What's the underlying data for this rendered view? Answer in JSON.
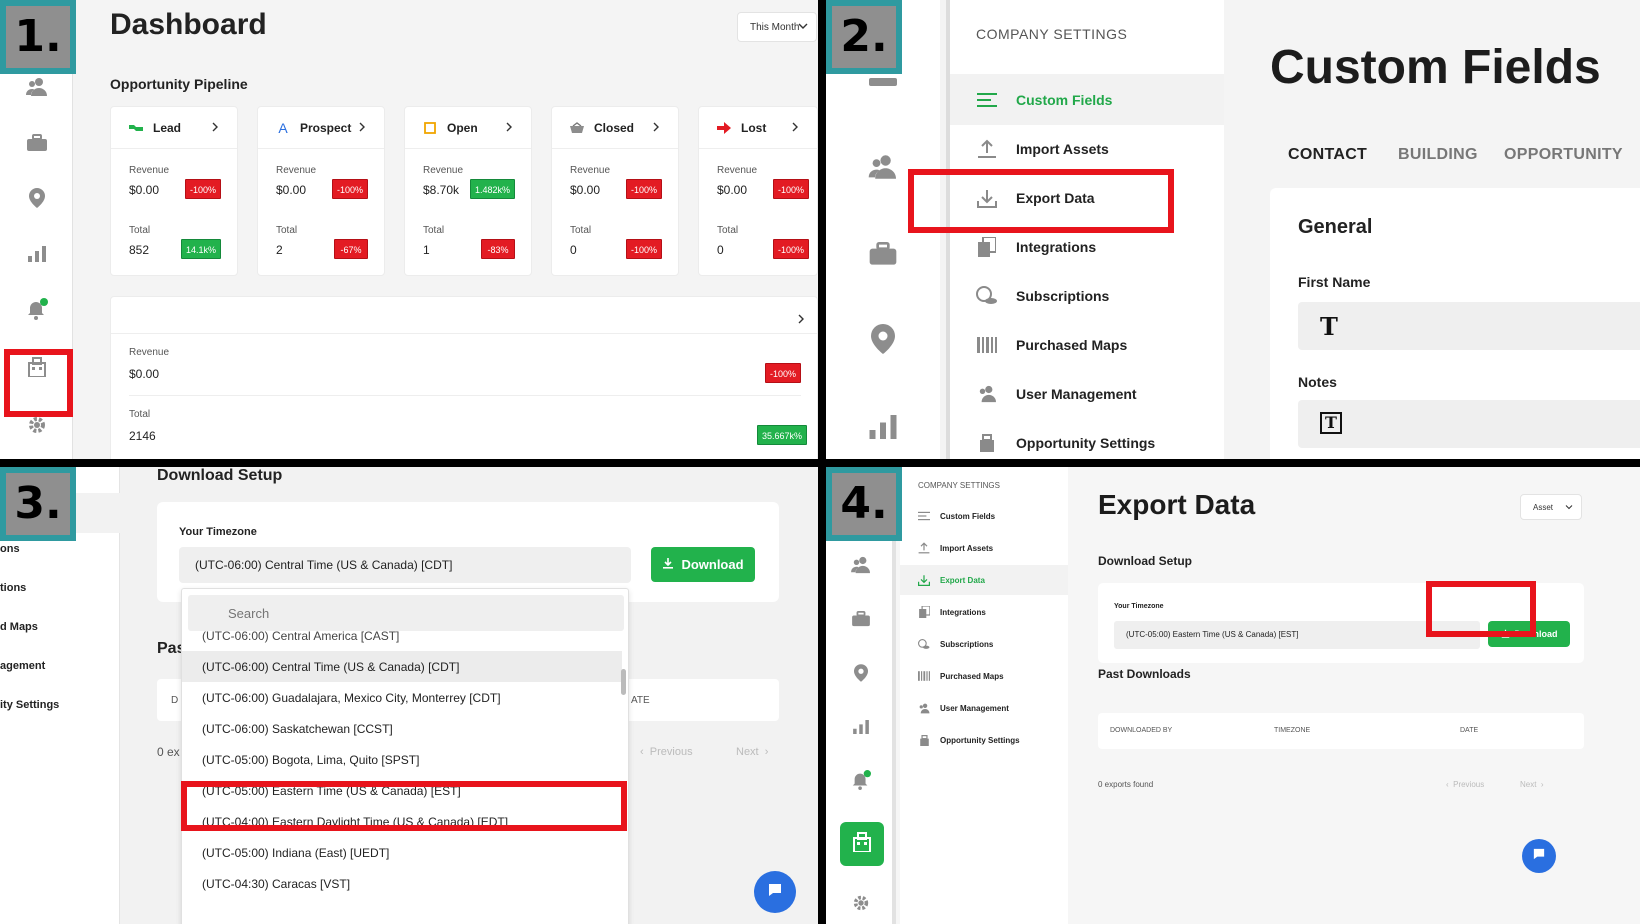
{
  "steps": [
    "1.",
    "2.",
    "3.",
    "4."
  ],
  "panel1": {
    "title": "Dashboard",
    "period_select": "This Month",
    "section_title": "Opportunity Pipeline",
    "revenue_label": "Revenue",
    "total_label": "Total",
    "stages": [
      {
        "name": "Lead",
        "revenue": "$0.00",
        "revenue_change": "-100%",
        "total": "852",
        "total_change": "14.1k%"
      },
      {
        "name": "Prospect",
        "revenue": "$0.00",
        "revenue_change": "-100%",
        "total": "2",
        "total_change": "-67%"
      },
      {
        "name": "Open",
        "revenue": "$8.70k",
        "revenue_change": "1.482k%",
        "total": "1",
        "total_change": "-83%"
      },
      {
        "name": "Closed",
        "revenue": "$0.00",
        "revenue_change": "-100%",
        "total": "0",
        "total_change": "-100%"
      },
      {
        "name": "Lost",
        "revenue": "$0.00",
        "revenue_change": "-100%",
        "total": "0",
        "total_change": "-100%"
      }
    ],
    "summary": {
      "revenue": "$0.00",
      "revenue_change": "-100%",
      "total": "2146",
      "total_change": "35.667k%"
    }
  },
  "panel2": {
    "menu_heading": "COMPANY SETTINGS",
    "menu_items": [
      "Custom Fields",
      "Import Assets",
      "Export Data",
      "Integrations",
      "Subscriptions",
      "Purchased Maps",
      "User Management",
      "Opportunity Settings"
    ],
    "title": "Custom Fields",
    "tabs": [
      "CONTACT",
      "BUILDING",
      "OPPORTUNITY"
    ],
    "card_title": "General",
    "fields": [
      {
        "label": "First Name",
        "type_glyph": "T"
      },
      {
        "label": "Notes",
        "type_glyph": "T"
      }
    ]
  },
  "panel3": {
    "sidebar_fragments": [
      "ons",
      "tions",
      "d Maps",
      "agement",
      "ity Settings"
    ],
    "title": "Download Setup",
    "timezone_label": "Your Timezone",
    "timezone_value": "(UTC-06:00) Central Time (US & Canada) [CDT]",
    "download_label": "Download",
    "past_fragment": "Pas",
    "table_fragments": [
      "D",
      "ATE"
    ],
    "count_fragment": "0 ex",
    "pager": {
      "previous": "Previous",
      "next": "Next"
    },
    "search_placeholder": "Search",
    "options": [
      "(UTC-06:00) Central America [CAST]",
      "(UTC-06:00) Central Time (US & Canada) [CDT]",
      "(UTC-06:00) Guadalajara, Mexico City, Monterrey [CDT]",
      "(UTC-06:00) Saskatchewan [CCST]",
      "(UTC-05:00) Bogota, Lima, Quito [SPST]",
      "(UTC-05:00) Eastern Time (US & Canada) [EST]",
      "(UTC-04:00) Eastern Daylight Time (US & Canada) [EDT]",
      "(UTC-05:00) Indiana (East) [UEDT]",
      "(UTC-04:30) Caracas [VST]"
    ]
  },
  "panel4": {
    "menu_heading": "COMPANY SETTINGS",
    "menu_items": [
      "Custom Fields",
      "Import Assets",
      "Export Data",
      "Integrations",
      "Subscriptions",
      "Purchased Maps",
      "User Management",
      "Opportunity Settings"
    ],
    "title": "Export Data",
    "asset_select": "Asset",
    "download_setup": "Download Setup",
    "timezone_label": "Your Timezone",
    "timezone_value": "(UTC-05:00) Eastern Time (US & Canada) [EST]",
    "download_label": "Download",
    "past_downloads": "Past Downloads",
    "columns": [
      "DOWNLOADED BY",
      "TIMEZONE",
      "DATE"
    ],
    "count": "0 exports found",
    "pager": {
      "previous": "Previous",
      "next": "Next"
    }
  },
  "colors": {
    "accent_green": "#22b24c",
    "highlight_red": "#e8141c",
    "badge_teal": "#2f9aa0",
    "chat_blue": "#2a6fe0"
  }
}
